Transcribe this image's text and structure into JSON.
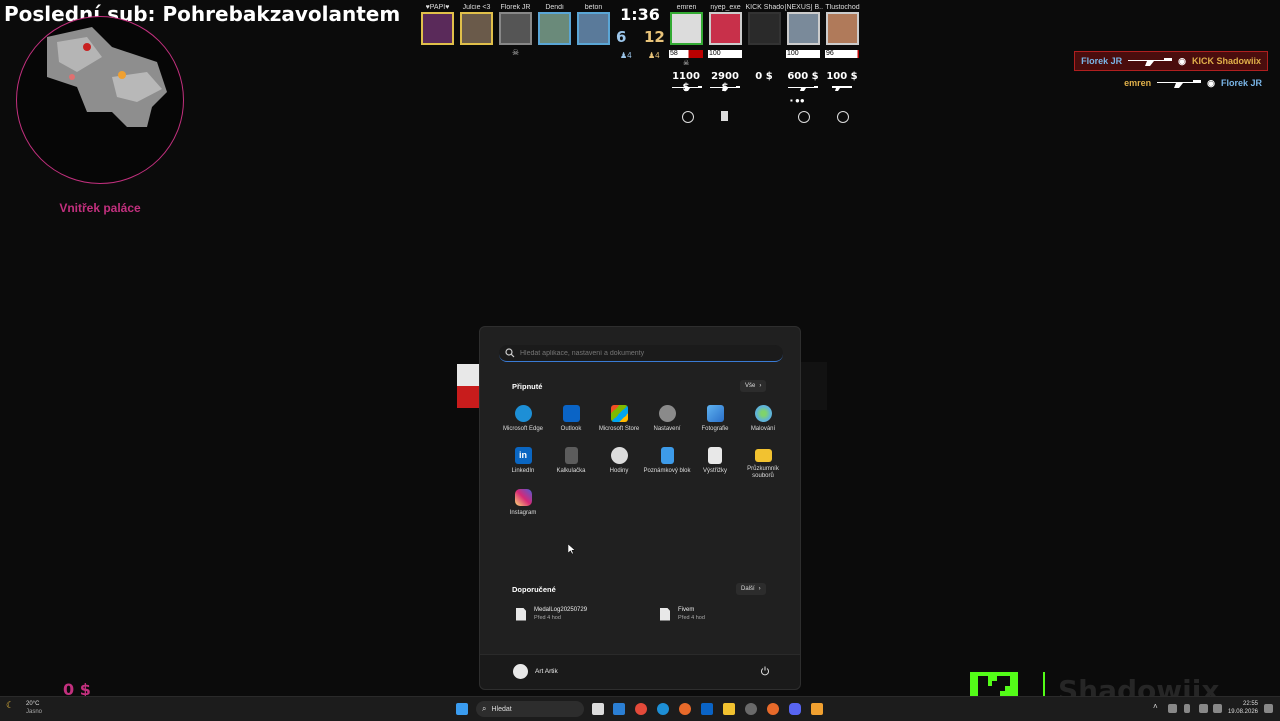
{
  "overlay": {
    "last_sub": "Poslední sub: Pohrebakzavolantem",
    "location": "Vnitřek paláce",
    "bottom_money": "0 $",
    "kick_channel": "Shadowiix"
  },
  "scoreboard": {
    "timer": "1:36",
    "score_ct": "6",
    "score_t": "12",
    "alive_ct": "4",
    "alive_t": "4",
    "ct_players": [
      {
        "name": "♥PAPI♥"
      },
      {
        "name": "Julcie <3"
      },
      {
        "name": "Florek JR"
      },
      {
        "name": "Dendi"
      },
      {
        "name": "beton"
      }
    ],
    "t_players": [
      {
        "name": "emren",
        "hp": "58",
        "money": "1100 $"
      },
      {
        "name": "nyep_exe",
        "hp": "100",
        "money": "2900 $"
      },
      {
        "name": "KICK Shado...",
        "hp": "",
        "money": "0 $"
      },
      {
        "name": "[NEXUS] B...",
        "hp": "100",
        "money": "600 $"
      },
      {
        "name": "Tlustochod",
        "hp": "96",
        "money": "100 $"
      }
    ]
  },
  "killfeed": [
    {
      "killer": "Florek JR",
      "victim": "KICK Shadowiix"
    },
    {
      "killer": "emren",
      "victim": "Florek JR"
    }
  ],
  "start_menu": {
    "search_placeholder": "Hledat aplikace, nastavení a dokumenty",
    "pinned_title": "Připnuté",
    "all_label": "Vše",
    "pinned": [
      {
        "label": "Microsoft Edge",
        "icon": "edge-icon",
        "color": "#1d8fd6"
      },
      {
        "label": "Outlook",
        "icon": "outlook-icon",
        "color": "#0a64c6"
      },
      {
        "label": "Microsoft Store",
        "icon": "store-icon",
        "color": "#2b7fd4"
      },
      {
        "label": "Nastavení",
        "icon": "gear-icon",
        "color": "#8a8a8a"
      },
      {
        "label": "Fotografie",
        "icon": "photos-icon",
        "color": "#3b8fe0"
      },
      {
        "label": "Malování",
        "icon": "paint-icon",
        "color": "#5fb3d9"
      },
      {
        "label": "LinkedIn",
        "icon": "linkedin-icon",
        "color": "#0a66c2"
      },
      {
        "label": "Kalkulačka",
        "icon": "calculator-icon",
        "color": "#5c5c5c"
      },
      {
        "label": "Hodiny",
        "icon": "clock-icon",
        "color": "#dcdcdc"
      },
      {
        "label": "Poznámkový blok",
        "icon": "notepad-icon",
        "color": "#3d9be9"
      },
      {
        "label": "Výstřižky",
        "icon": "snipping-icon",
        "color": "#e8e8e8"
      },
      {
        "label": "Průzkumník souborů",
        "icon": "folder-icon",
        "color": "#f2c230"
      },
      {
        "label": "Instagram",
        "icon": "instagram-icon",
        "color": "#d6307f"
      }
    ],
    "recommended_title": "Doporučené",
    "more_label": "Další",
    "recommended": [
      {
        "name": "MedalLog20250729",
        "time": "Před 4 hod"
      },
      {
        "name": "Fivem",
        "time": "Před 4 hod"
      }
    ],
    "user_name": "Art Artik"
  },
  "taskbar": {
    "weather_temp": "20°C",
    "weather_desc": "Jasno",
    "search_label": "Hledat",
    "time": "22:55",
    "date": "19.08.2026"
  },
  "colors": {
    "accent_pink": "#c2307e",
    "kick_green": "#53fc18"
  }
}
